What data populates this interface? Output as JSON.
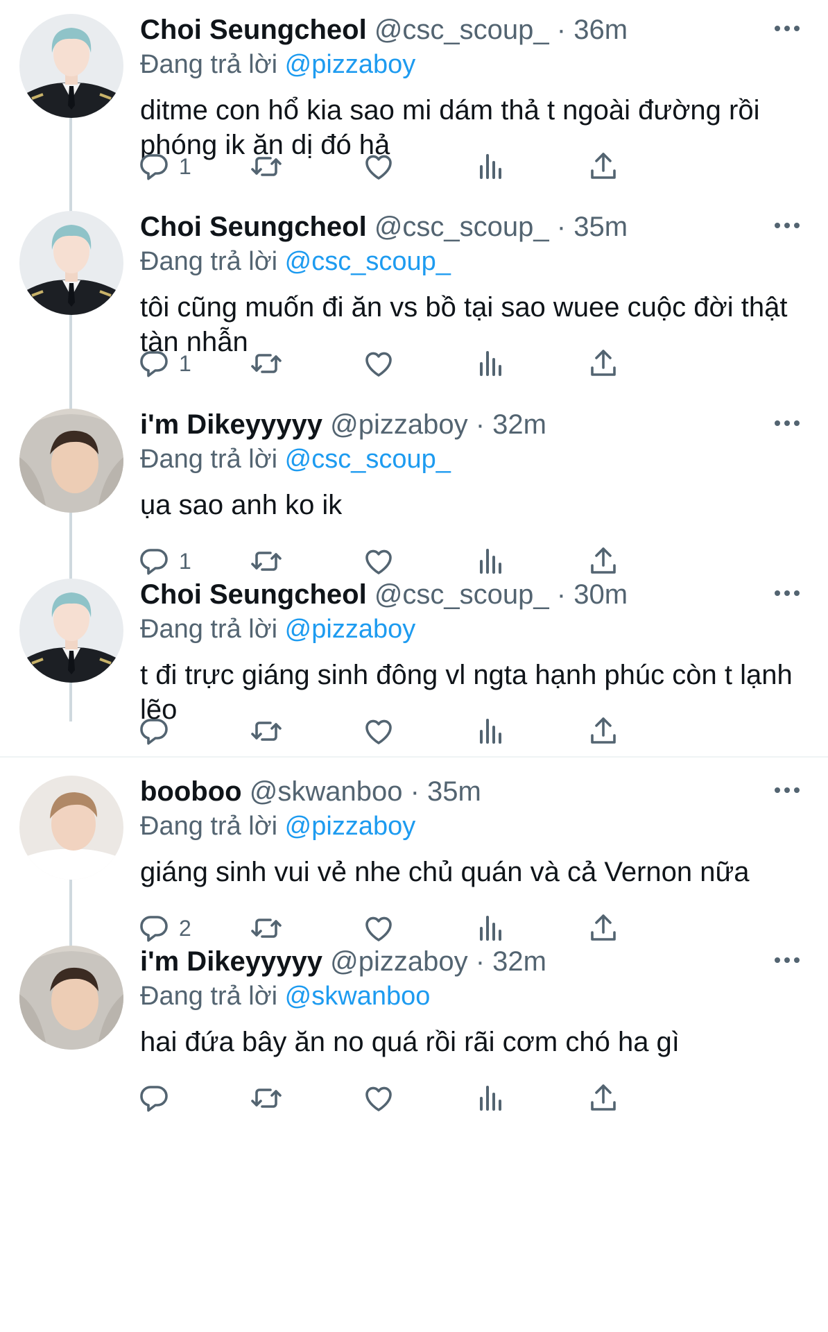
{
  "colors": {
    "text": "#0f1419",
    "secondary": "#536471",
    "link": "#1d9bf0",
    "thread": "#cfd9de"
  },
  "tweets": [
    {
      "name": "Choi Seungcheol",
      "meta": "@csc_scoup_ · 36m",
      "reply_prefix": "Đang trả lời",
      "reply_handle": "@pizzaboy",
      "text": "ditme con hổ kia sao mi dám thả t ngoài đường rồi phóng ik ăn dị đó hả",
      "reply_count": "1",
      "avatar": "avatar-choi"
    },
    {
      "name": "Choi Seungcheol",
      "meta": "@csc_scoup_ · 35m",
      "reply_prefix": "Đang trả lời",
      "reply_handle": "@csc_scoup_",
      "text": "tôi cũng muốn đi ăn vs bồ tại sao wuee cuộc đời thật tàn nhẫn",
      "reply_count": "1",
      "avatar": "avatar-choi"
    },
    {
      "name": "i'm Dikeyyyyy",
      "meta": "@pizzaboy · 32m",
      "reply_prefix": "Đang trả lời",
      "reply_handle": "@csc_scoup_",
      "text": "ụa sao anh ko ik",
      "reply_count": "1",
      "avatar": "avatar-dikey"
    },
    {
      "name": "Choi Seungcheol",
      "meta": "@csc_scoup_ · 30m",
      "reply_prefix": "Đang trả lời",
      "reply_handle": "@pizzaboy",
      "text": "t đi trực giáng sinh đông vl ngta hạnh phúc còn t lạnh lẽo",
      "reply_count": "",
      "avatar": "avatar-choi"
    },
    {
      "name": "booboo",
      "meta": "@skwanboo · 35m",
      "reply_prefix": "Đang trả lời",
      "reply_handle": "@pizzaboy",
      "text": "giáng sinh vui vẻ nhe chủ quán và cả Vernon nữa",
      "reply_count": "2",
      "avatar": "avatar-booboo"
    },
    {
      "name": "i'm Dikeyyyyy",
      "meta": "@pizzaboy · 32m",
      "reply_prefix": "Đang trả lời",
      "reply_handle": "@skwanboo",
      "text": "hai đứa bây ăn no quá rồi rãi cơm chó ha gì",
      "reply_count": "",
      "avatar": "avatar-dikey"
    }
  ]
}
